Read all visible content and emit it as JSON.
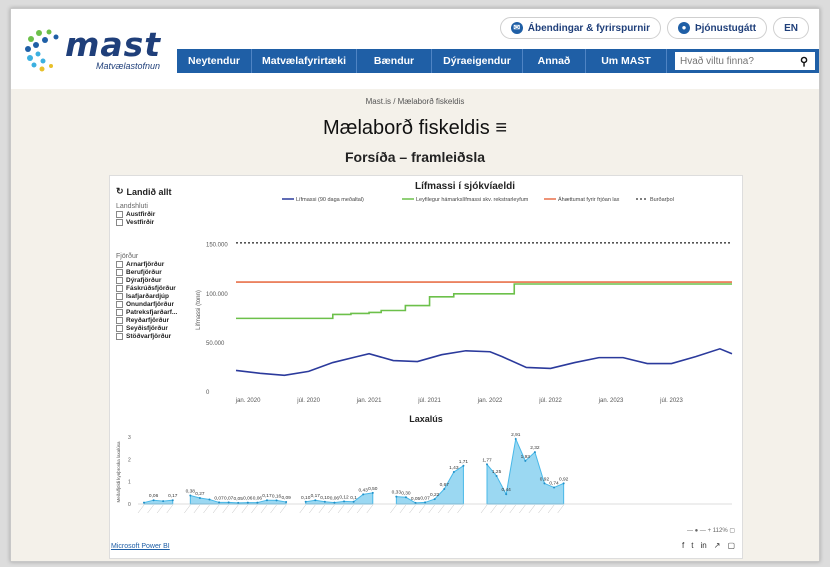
{
  "header": {
    "logo_text": "mast",
    "logo_sub": "Matvælastofnun",
    "top_links": [
      {
        "label": "Ábendingar & fyrirspurnir",
        "icon": "chat-icon"
      },
      {
        "label": "Þjónustugátt",
        "icon": "user-icon"
      },
      {
        "label": "EN"
      }
    ],
    "nav": [
      "Neytendur",
      "Matvælafyrirtæki",
      "Bændur",
      "Dýraeigendur",
      "Annað",
      "Um MAST"
    ],
    "search_placeholder": "Hvað viltu finna?",
    "accent": "#1f5fa6"
  },
  "breadcrumb": "Mast.is / Mælaborð fiskeldis",
  "title": "Mælaborð fiskeldis",
  "subtitle": "Forsíða – framleiðsla",
  "filters": {
    "reset_label": "Landið allt",
    "region_title": "Landshluti",
    "regions": [
      "Austfirðir",
      "Vestfirðir"
    ],
    "fjord_title": "Fjörður",
    "fjords": [
      "Arnarfjörður",
      "Berufjörður",
      "Dýrafjörður",
      "Fáskrúðsfjörður",
      "Ísafjarðardjúp",
      "Önundarfjörður",
      "Patreksfjarðarf...",
      "Reyðarfjörður",
      "Seyðisfjörður",
      "Stöðvarfjörður"
    ]
  },
  "chart_data": [
    {
      "type": "line",
      "title": "Lífmassi í sjókvíaeldi",
      "ylabel": "Lífmassi (tonn)",
      "x_ticks": [
        "jan. 2020",
        "júl. 2020",
        "jan. 2021",
        "júl. 2021",
        "jan. 2022",
        "júl. 2022",
        "jan. 2023",
        "júl. 2023"
      ],
      "y_ticks": [
        "0",
        "50.000",
        "100.000",
        "150.000"
      ],
      "ylim": [
        0,
        165000
      ],
      "series": [
        {
          "name": "Lífmassi (90 daga meðaltal)",
          "color": "#2b3a9c",
          "x": [
            2019.9,
            2020.1,
            2020.3,
            2020.5,
            2020.7,
            2020.9,
            2021.0,
            2021.2,
            2021.4,
            2021.6,
            2021.8,
            2022.0,
            2022.1,
            2022.3,
            2022.5,
            2022.7,
            2022.9,
            2023.1,
            2023.3,
            2023.5,
            2023.7,
            2023.9,
            2024.0
          ],
          "y": [
            22000,
            19000,
            17000,
            21000,
            30000,
            36000,
            39000,
            32000,
            31000,
            38000,
            42000,
            41000,
            36000,
            25000,
            24000,
            30000,
            35000,
            35000,
            29000,
            29000,
            36000,
            44000,
            39000
          ]
        },
        {
          "name": "Leyfilegur hámarkslífmassi skv. rekstrarleyfum",
          "color": "#6cc04a",
          "step": true,
          "x": [
            2019.9,
            2020.5,
            2020.7,
            2020.85,
            2021.0,
            2021.1,
            2021.3,
            2021.5,
            2021.7,
            2022.2,
            2022.6,
            2024.0
          ],
          "y": [
            75000,
            75000,
            79000,
            80000,
            81000,
            83000,
            88000,
            97000,
            100000,
            110000,
            110000,
            110000
          ]
        },
        {
          "name": "Áhættumat fyrir frjóan lax",
          "color": "#e8704a",
          "x": [
            2019.9,
            2024.0
          ],
          "y": [
            112000,
            112000
          ]
        },
        {
          "name": "Burðarþol",
          "color": "#555555",
          "dash": true,
          "x": [
            2019.9,
            2024.0
          ],
          "y": [
            152000,
            152000
          ]
        }
      ]
    },
    {
      "type": "area",
      "title": "Laxalús",
      "ylabel": "Meðalfjöldi kynþroska laxalúsa",
      "y_ticks": [
        "0",
        "1",
        "2",
        "3"
      ],
      "ylim": [
        0,
        3.4
      ],
      "color": "#48b8e8",
      "segments": [
        {
          "values": [
            0.06,
            0.17,
            0.13,
            0.17
          ],
          "labels": [
            "",
            "0,06",
            "",
            "0,17"
          ]
        },
        {
          "values": [
            0.38,
            0.27,
            0.2,
            0.07,
            0.07,
            0.05,
            0.06,
            0.06,
            0.17,
            0.16,
            0.09
          ],
          "labels": [
            "0,38",
            "0,27",
            "",
            "0,07",
            "0,07",
            "0,05",
            "0,06",
            "0,06",
            "0,17",
            "0,16",
            "0,09"
          ]
        },
        {
          "values": [
            0.1,
            0.17,
            0.1,
            0.06,
            0.12,
            0.1,
            0.43,
            0.5
          ],
          "labels": [
            "0,10",
            "0,17",
            "0,10",
            "0,06",
            "0,12",
            "0,1",
            "0,43",
            "0,50"
          ]
        },
        {
          "values": [
            0.33,
            0.3,
            0.05,
            0.07,
            0.22,
            0.67,
            1.43,
            1.71
          ],
          "labels": [
            "0,33",
            "0,30",
            "0,05",
            "0,07",
            "0,22",
            "0,67",
            "1,43",
            "1,71"
          ]
        },
        {
          "values": [
            1.77,
            1.25,
            0.44,
            2.91,
            1.93,
            2.32,
            0.92,
            0.74,
            0.92
          ],
          "labels": [
            "1,77",
            "1,25",
            "0,44",
            "2,91",
            "1,93",
            "2,32",
            "0,92",
            "0,74",
            "0,92"
          ]
        }
      ]
    }
  ],
  "footer": {
    "link": "Microsoft Power BI",
    "zoom": "112%",
    "icons": [
      "facebook-icon",
      "twitter-icon",
      "linkedin-icon",
      "share-icon",
      "fullscreen-icon"
    ]
  }
}
